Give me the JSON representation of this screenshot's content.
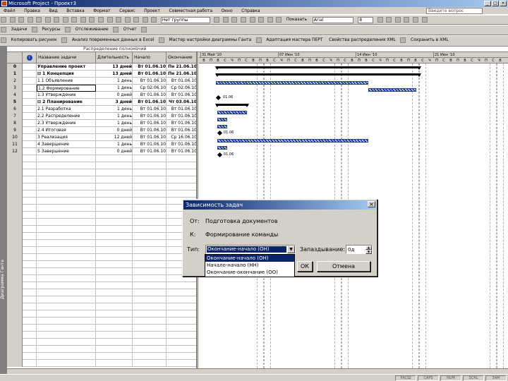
{
  "window": {
    "title": "Microsoft Project - Проект3"
  },
  "menu": [
    "Файл",
    "Правка",
    "Вид",
    "Вставка",
    "Формат",
    "Сервис",
    "Проект",
    "Совместная работа",
    "Окно",
    "Справка"
  ],
  "help_box": "Введите вопрос",
  "toolbar1": {
    "view_combo": "Нет группы",
    "font_combo": "Arial",
    "size_combo": "8",
    "filter_label": "Показать"
  },
  "toolbar2": {
    "tasks": "Задачи",
    "resources": "Ресурсы",
    "tracking": "Отслеживание",
    "report": "Отчет"
  },
  "toolbar3": {
    "items": [
      "Копировать рисунок",
      "Анализ повременных данных в Excel",
      "Мастер настройки диаграммы Ганта",
      "Адаптация мастера ПЕРТ",
      "Свойства распределения XML",
      "Сохранить в XML"
    ]
  },
  "entry_bar": "Распределение полномочий",
  "grid": {
    "headers": {
      "info": "i",
      "name": "Название задачи",
      "duration": "Длительность",
      "start": "Начало",
      "finish": "Окончание"
    },
    "rows": [
      {
        "id": "0",
        "name": "Управление проект",
        "duration": "13 дней",
        "start": "Вт 01.06.10",
        "finish": "Пн 21.06.10"
      },
      {
        "id": "1",
        "name": "⊟ 1 Концепция",
        "duration": "13 дней",
        "start": "Вт 01.06.10",
        "finish": "Пн 21.06.10"
      },
      {
        "id": "2",
        "name": "1.1 Объявление",
        "duration": "1 день",
        "start": "Вт 01.06.10",
        "finish": "Вт 01.06.10"
      },
      {
        "id": "3",
        "name": "1.2 Формирование",
        "duration": "1 день",
        "start": "Ср 02.06.10",
        "finish": "Ср 02.06.10"
      },
      {
        "id": "4",
        "name": "1.3 Утверждение",
        "duration": "0 дней",
        "start": "Вт 01.06.10",
        "finish": "Вт 01.06.10"
      },
      {
        "id": "5",
        "name": "⊟ 2 Планирование",
        "duration": "3 дней",
        "start": "Вт 01.06.10",
        "finish": "Чт 03.06.10"
      },
      {
        "id": "6",
        "name": "2.1 Разработка",
        "duration": "1 день",
        "start": "Вт 01.06.10",
        "finish": "Вт 01.06.10"
      },
      {
        "id": "7",
        "name": "2.2 Распределение",
        "duration": "1 день",
        "start": "Вт 01.06.10",
        "finish": "Вт 01.06.10"
      },
      {
        "id": "8",
        "name": "2.3 Утверждение",
        "duration": "1 день",
        "start": "Вт 01.06.10",
        "finish": "Вт 01.06.10"
      },
      {
        "id": "9",
        "name": "2.4 Итоговая",
        "duration": "0 дней",
        "start": "Вт 01.06.10",
        "finish": "Вт 01.06.10"
      },
      {
        "id": "10",
        "name": "3 Реализация",
        "duration": "12 дней",
        "start": "Вт 01.06.10",
        "finish": "Ср 16.06.10"
      },
      {
        "id": "11",
        "name": "4 Завершение",
        "duration": "1 день",
        "start": "Вт 01.06.10",
        "finish": "Вт 01.06.10"
      },
      {
        "id": "12",
        "name": "5 Завершение",
        "duration": "0 дней",
        "start": "Вт 01.06.10",
        "finish": "Вт 01.06.10"
      }
    ]
  },
  "gantt": {
    "weeks": [
      "31 Май '10",
      "07 Июн '10",
      "14 Июн '10",
      "21 Июн '10"
    ],
    "day_letters": [
      "В",
      "П",
      "В",
      "С",
      "Ч",
      "П",
      "С"
    ],
    "milestone_labels": [
      "01.06",
      "01.06",
      "01.06"
    ]
  },
  "dialog": {
    "title": "Зависимость задач",
    "from_label": "От:",
    "from_value": "Подготовка документов",
    "to_label": "К:",
    "to_value": "Формирование команды",
    "type_label": "Тип:",
    "type_value": "Окончание-начало (ОН)",
    "lag_label": "Запаздывание:",
    "lag_value": "0д",
    "options": [
      "Окончание-начало (ОН)",
      "Начало-начало (НН)",
      "Окончание-окончание (ОО)"
    ],
    "ok_label": "ОК",
    "cancel_label": "Отмена"
  },
  "viewbar_label": "Диаграмма Ганта",
  "status": [
    "РАСШ",
    "CAPS",
    "NUM",
    "SCRL",
    "ЗАМ"
  ]
}
